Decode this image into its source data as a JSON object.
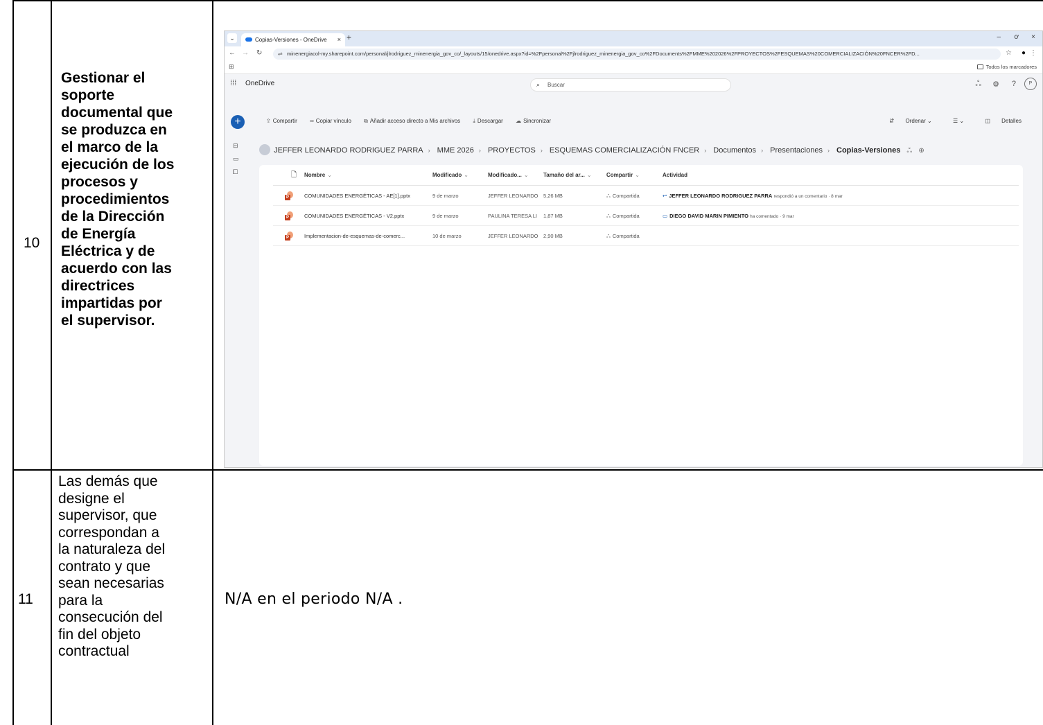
{
  "rows": [
    {
      "number": "10",
      "description_lines": [
        "Gestionar el",
        "soporte",
        "documental que",
        "se produzca en",
        "el marco de la",
        "ejecución de los",
        "procesos y",
        "procedimientos",
        "de la Dirección",
        "de Energía",
        "Eléctrica y de",
        "acuerdo con las",
        "directrices",
        "impartidas por",
        "el supervisor."
      ]
    },
    {
      "number": "11",
      "description_lines": [
        "Las demás que",
        "designe el",
        "supervisor, que",
        "correspondan a",
        "la naturaleza del",
        "contrato y que",
        "sean necesarias",
        "para la",
        "consecución del",
        "fin del objeto",
        "contractual"
      ],
      "evidence": {
        "value1": "N/A",
        "middle": "en el periodo",
        "value2": "N/A",
        "end": "."
      }
    }
  ],
  "browser": {
    "tab_title": "Copias-Versiones - OneDrive",
    "tab_close": "×",
    "new_tab": "+",
    "url": "minenergiacol-my.sharepoint.com/personal/jlrodriguez_minenergia_gov_co/_layouts/15/onedrive.aspx?id=%2Fpersonal%2Fjlrodriguez_minenergia_gov_co%2FDocuments%2FMME%202026%2FPROYECTOS%2FESQUEMAS%20COMERCIALIZACIÓN%20FNCER%2FD...",
    "all_bookmarks": "Todos los marcadores",
    "window_minimize": "–",
    "window_restore": "ơ",
    "window_close": "×"
  },
  "onedrive": {
    "app_name": "OneDrive",
    "search_placeholder": "Buscar",
    "avatar_initial": "P",
    "commands": [
      "Compartir",
      "Copiar vínculo",
      "Añadir acceso directo a Mis archivos",
      "Descargar",
      "Sincronizar"
    ],
    "sort_label": "Ordenar",
    "details_label": "Detalles",
    "breadcrumb": [
      "JEFFER LEONARDO RODRIGUEZ PARRA",
      "MME 2026",
      "PROYECTOS",
      "ESQUEMAS COMERCIALIZACIÓN FNCER",
      "Documentos",
      "Presentaciones"
    ],
    "current_folder": "Copias-Versiones",
    "columns": [
      "Nombre",
      "Modificado",
      "Modificado...",
      "Tamaño del ar...",
      "Compartir",
      "Actividad"
    ],
    "files": [
      {
        "name": "COMUNIDADES ENERGÉTICAS - AE[1].pptx",
        "modified": "9 de marzo",
        "modified_by": "JEFFER LEONARDO",
        "size": "5,26 MB",
        "sharing": "Compartida",
        "activity_user": "JEFFER LEONARDO RODRIGUEZ PARRA",
        "activity_text": "respondió a un comentario · 8 mar"
      },
      {
        "name": "COMUNIDADES ENERGÉTICAS - V2.pptx",
        "modified": "9 de marzo",
        "modified_by": "PAULINA TERESA LI",
        "size": "1,87 MB",
        "sharing": "Compartida",
        "activity_user": "DIEGO DAVID MARIN PIMIENTO",
        "activity_text": "ha comentado · 9 mar"
      },
      {
        "name": "Implementacion-de-esquemas-de-comerc...",
        "modified": "10 de marzo",
        "modified_by": "JEFFER LEONARDO",
        "size": "2,90 MB",
        "sharing": "Compartida",
        "activity_user": "",
        "activity_text": ""
      }
    ]
  }
}
